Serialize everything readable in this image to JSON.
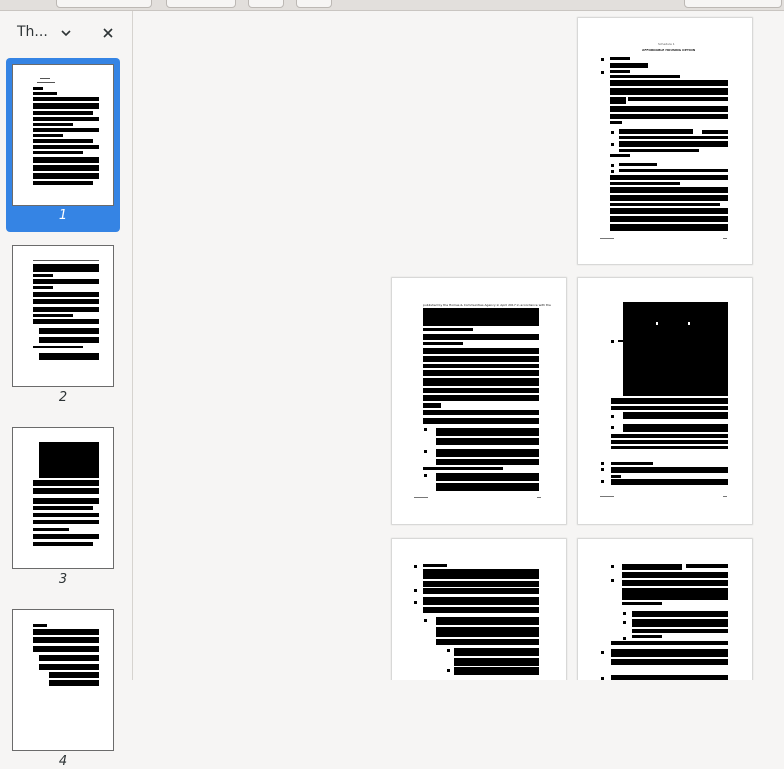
{
  "sidebar": {
    "title": "Th...",
    "thumbnails": [
      {
        "label": "1",
        "selected": true
      },
      {
        "label": "2",
        "selected": false
      },
      {
        "label": "3",
        "selected": false
      },
      {
        "label": "4",
        "selected": false
      }
    ]
  },
  "pages": [
    {
      "heading": "Schedule 1",
      "subheading": "AFFORDABLE HOUSING OPTION"
    },
    {
      "lead_text": "published by the Homes & Communities Agency in April 2017 in accordance with the"
    }
  ],
  "icons": {
    "sidebar_dropdown": "chevron-down-icon",
    "sidebar_close": "close-icon"
  },
  "colors": {
    "selection": "#3584e4",
    "background": "#f6f5f4"
  }
}
